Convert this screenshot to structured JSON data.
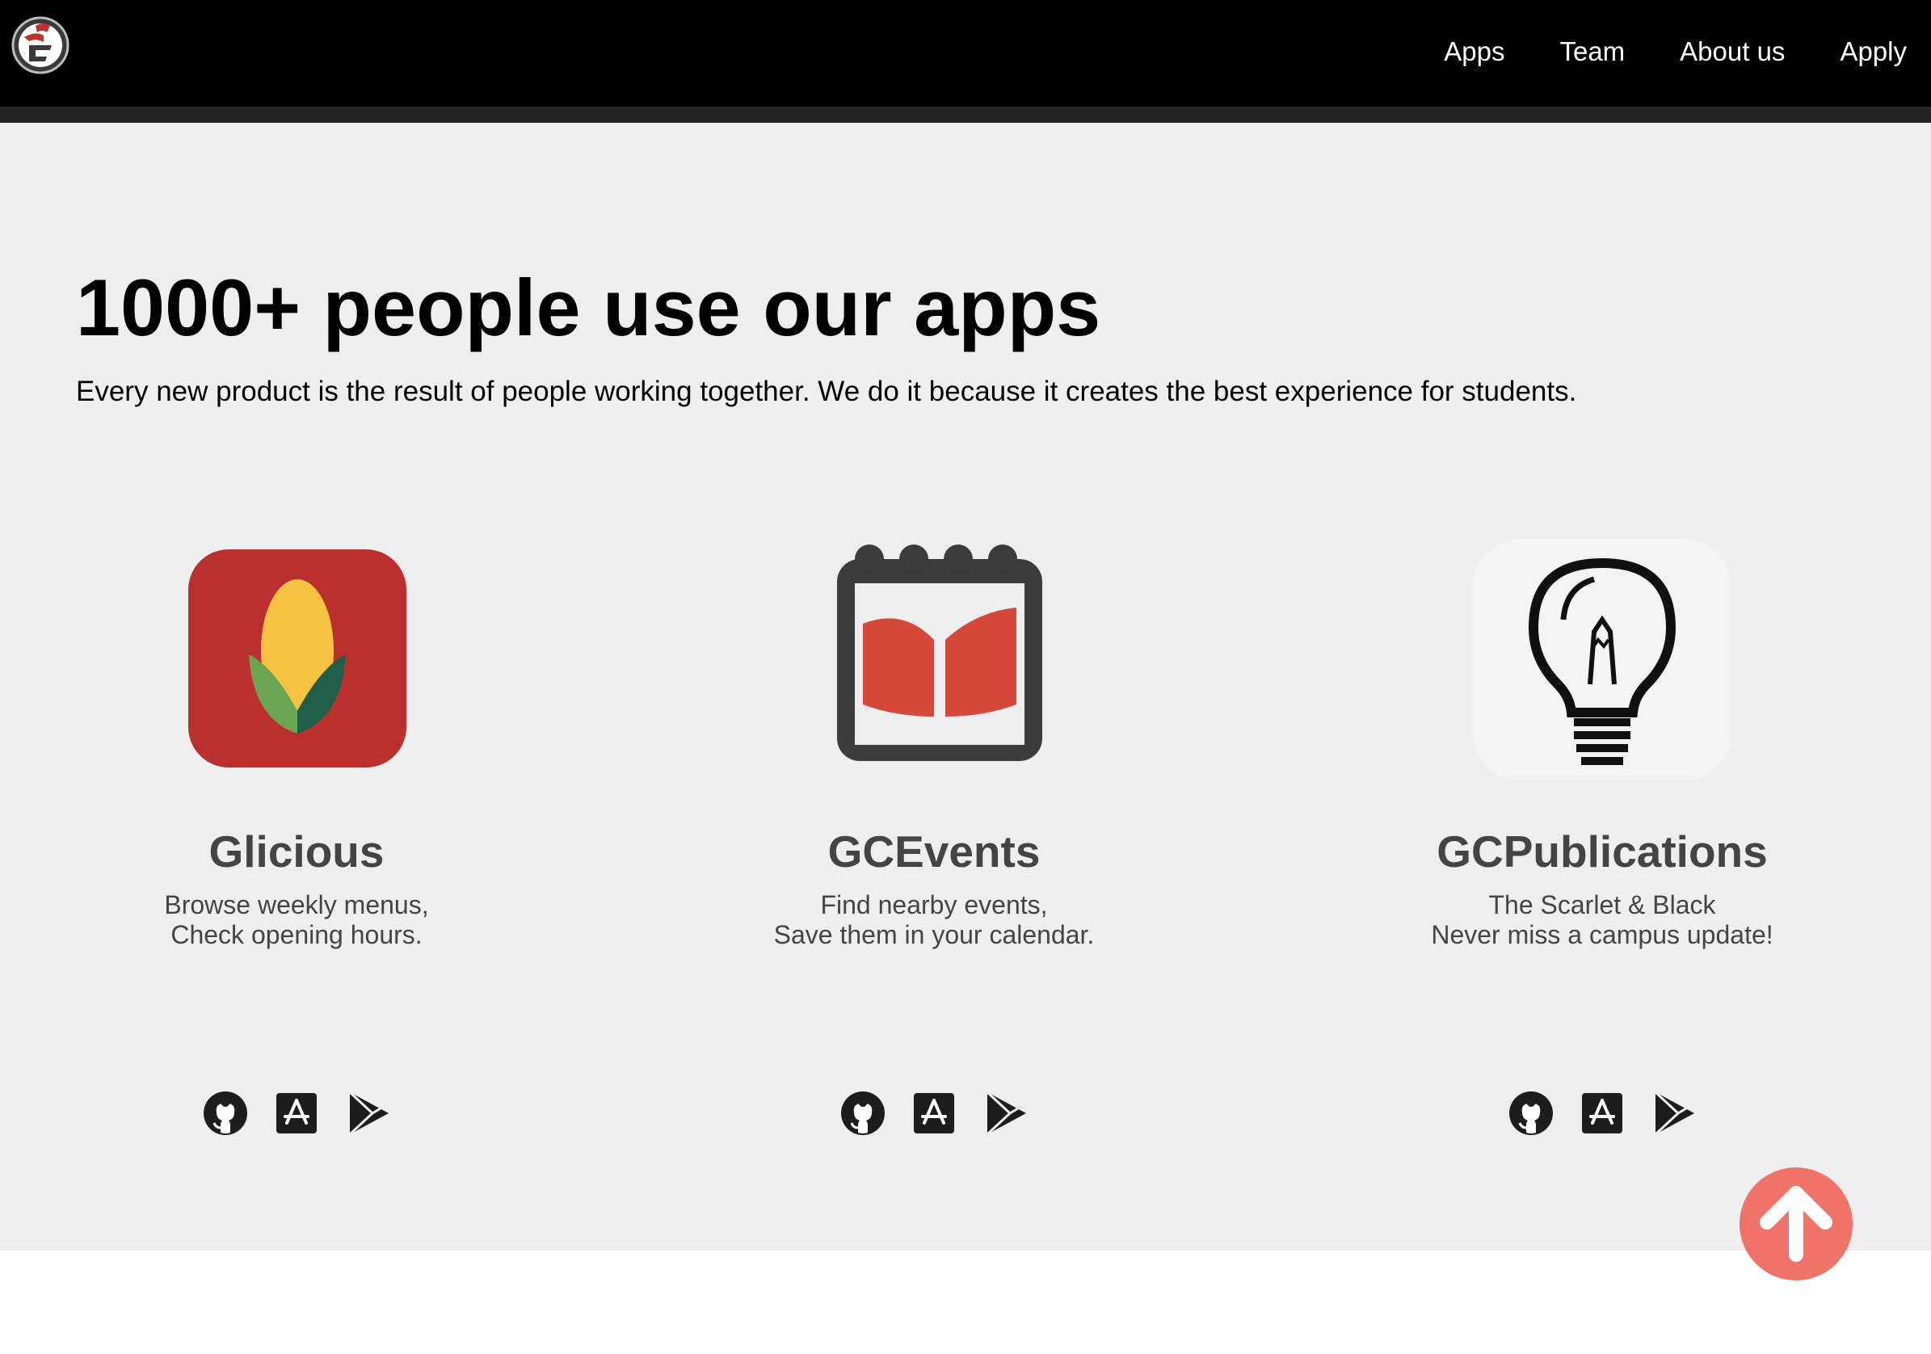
{
  "nav": {
    "logo_icon": "gf-logo-icon",
    "links": [
      "Apps",
      "Team",
      "About us",
      "Apply"
    ]
  },
  "hero": {
    "title": "1000+ people use our apps",
    "subtitle": "Every new product is the result of people working together. We do it because it creates the best experience for students."
  },
  "apps": [
    {
      "name": "Glicious",
      "desc_line1": "Browse weekly menus,",
      "desc_line2": "Check opening hours.",
      "icon": "corn-icon"
    },
    {
      "name": "GCEvents",
      "desc_line1": "Find nearby events,",
      "desc_line2": "Save them in your calendar.",
      "icon": "calendar-icon"
    },
    {
      "name": "GCPublications",
      "desc_line1": "The Scarlet & Black",
      "desc_line2": "Never miss a campus update!",
      "icon": "lightbulb-icon"
    }
  ],
  "store_icons": [
    "github-icon",
    "app-store-icon",
    "play-store-icon"
  ],
  "colors": {
    "header_bg": "#000000",
    "content_bg": "#eeeeee",
    "accent_red": "#c0302d",
    "back_to_top": "#f0736a"
  },
  "back_to_top_icon": "arrow-up-icon"
}
